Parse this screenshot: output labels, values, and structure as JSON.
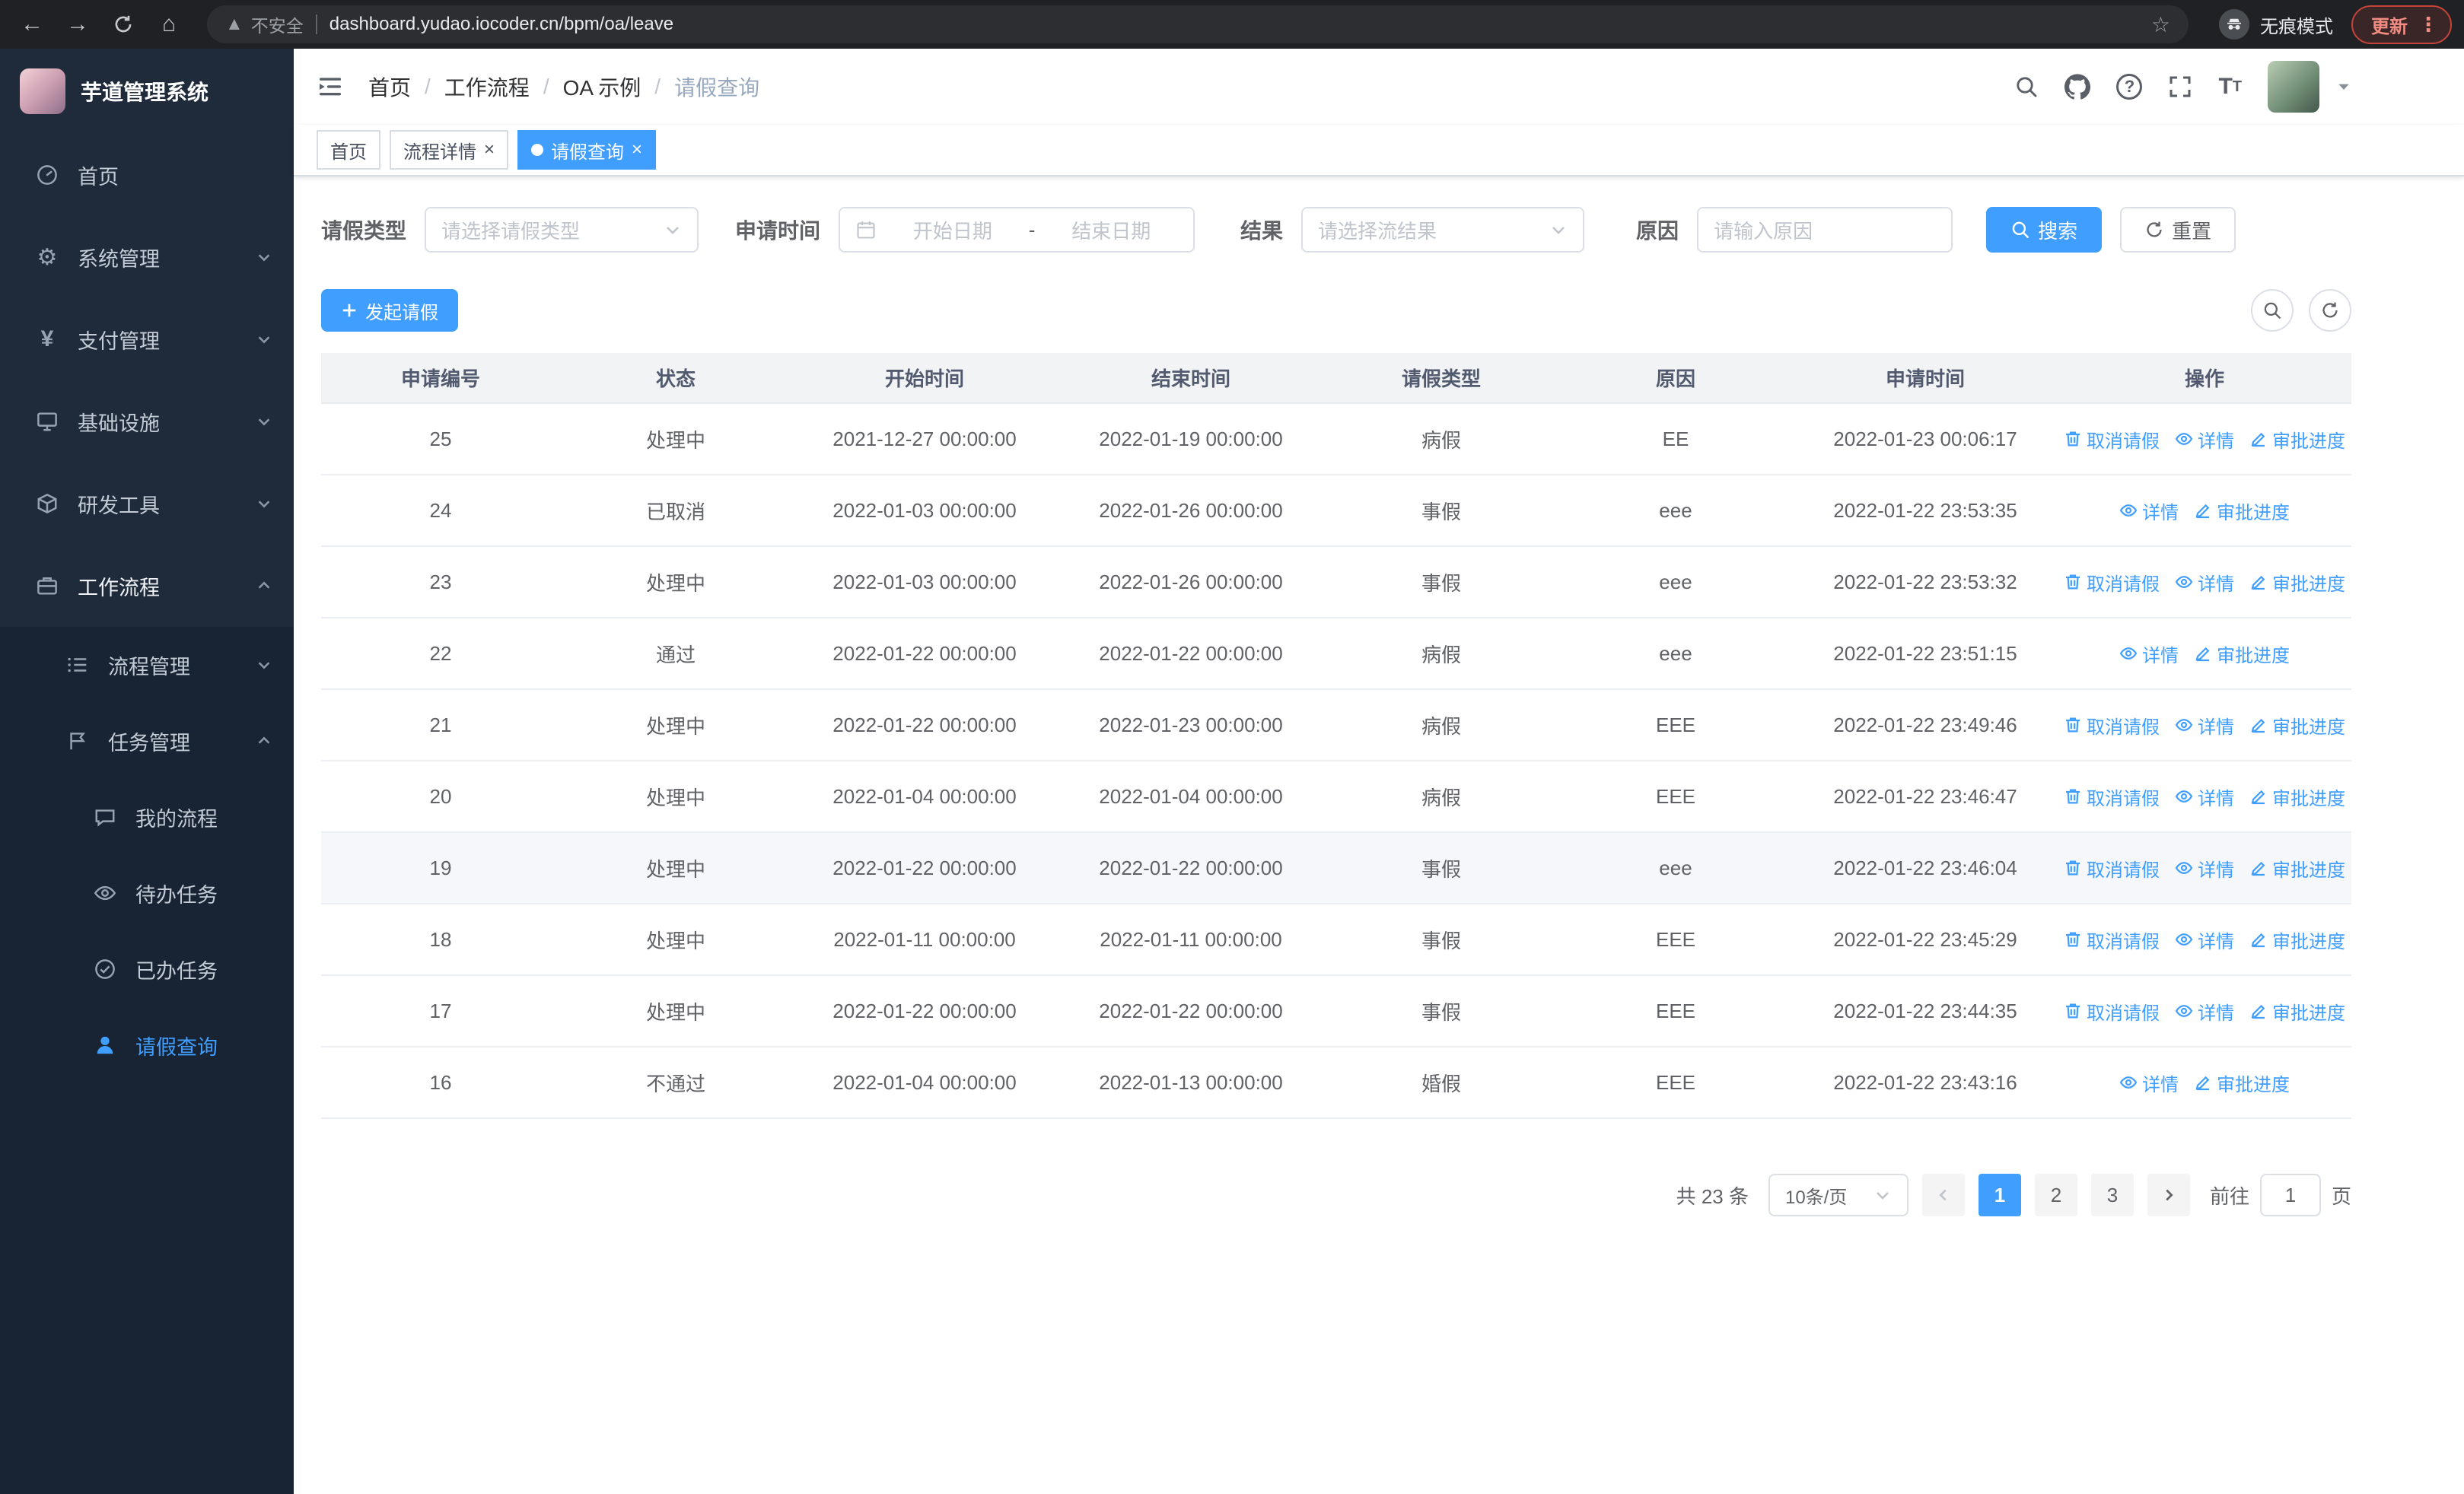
{
  "browser": {
    "security_label": "不安全",
    "url": "dashboard.yudao.iocoder.cn/bpm/oa/leave",
    "incognito_label": "无痕模式",
    "update_label": "更新"
  },
  "sidebar": {
    "logo_title": "芋道管理系统",
    "items": [
      {
        "label": "首页",
        "icon": "dashboard-icon"
      },
      {
        "label": "系统管理",
        "icon": "gear-icon"
      },
      {
        "label": "支付管理",
        "icon": "yen-icon"
      },
      {
        "label": "基础设施",
        "icon": "monitor-icon"
      },
      {
        "label": "研发工具",
        "icon": "toolbox-icon"
      },
      {
        "label": "工作流程",
        "icon": "briefcase-icon",
        "expanded": true
      }
    ],
    "sub_items": [
      {
        "label": "流程管理",
        "icon": "list-icon",
        "expanded": false
      },
      {
        "label": "任务管理",
        "icon": "flag-icon",
        "expanded": true
      }
    ],
    "leaf_items": [
      {
        "label": "我的流程",
        "icon": "chat-icon"
      },
      {
        "label": "待办任务",
        "icon": "eye-icon"
      },
      {
        "label": "已办任务",
        "icon": "check-circle-icon"
      },
      {
        "label": "请假查询",
        "icon": "user-icon",
        "active": true
      }
    ]
  },
  "header": {
    "breadcrumb": [
      "首页",
      "工作流程",
      "OA 示例",
      "请假查询"
    ],
    "separator": "/"
  },
  "tabs": [
    {
      "label": "首页",
      "closable": false,
      "active": false
    },
    {
      "label": "流程详情",
      "closable": true,
      "active": false
    },
    {
      "label": "请假查询",
      "closable": true,
      "active": true
    }
  ],
  "filters": {
    "leave_type_label": "请假类型",
    "leave_type_placeholder": "请选择请假类型",
    "apply_time_label": "申请时间",
    "start_date_placeholder": "开始日期",
    "range_separator": "-",
    "end_date_placeholder": "结束日期",
    "result_label": "结果",
    "result_placeholder": "请选择流结果",
    "reason_label": "原因",
    "reason_placeholder": "请输入原因",
    "search_button": "搜索",
    "reset_button": "重置"
  },
  "toolbar": {
    "create_button": "发起请假"
  },
  "table": {
    "columns": [
      "申请编号",
      "状态",
      "开始时间",
      "结束时间",
      "请假类型",
      "原因",
      "申请时间",
      "操作"
    ],
    "actions": {
      "cancel": "取消请假",
      "detail": "详情",
      "progress": "审批进度"
    },
    "rows": [
      {
        "id": "25",
        "status": "处理中",
        "start": "2021-12-27 00:00:00",
        "end": "2022-01-19 00:00:00",
        "type": "病假",
        "reason": "EE",
        "applied": "2022-01-23 00:06:17",
        "cancellable": true,
        "highlighted": false
      },
      {
        "id": "24",
        "status": "已取消",
        "start": "2022-01-03 00:00:00",
        "end": "2022-01-26 00:00:00",
        "type": "事假",
        "reason": "eee",
        "applied": "2022-01-22 23:53:35",
        "cancellable": false,
        "highlighted": false
      },
      {
        "id": "23",
        "status": "处理中",
        "start": "2022-01-03 00:00:00",
        "end": "2022-01-26 00:00:00",
        "type": "事假",
        "reason": "eee",
        "applied": "2022-01-22 23:53:32",
        "cancellable": true,
        "highlighted": false
      },
      {
        "id": "22",
        "status": "通过",
        "start": "2022-01-22 00:00:00",
        "end": "2022-01-22 00:00:00",
        "type": "病假",
        "reason": "eee",
        "applied": "2022-01-22 23:51:15",
        "cancellable": false,
        "highlighted": false
      },
      {
        "id": "21",
        "status": "处理中",
        "start": "2022-01-22 00:00:00",
        "end": "2022-01-23 00:00:00",
        "type": "病假",
        "reason": "EEE",
        "applied": "2022-01-22 23:49:46",
        "cancellable": true,
        "highlighted": false
      },
      {
        "id": "20",
        "status": "处理中",
        "start": "2022-01-04 00:00:00",
        "end": "2022-01-04 00:00:00",
        "type": "病假",
        "reason": "EEE",
        "applied": "2022-01-22 23:46:47",
        "cancellable": true,
        "highlighted": false
      },
      {
        "id": "19",
        "status": "处理中",
        "start": "2022-01-22 00:00:00",
        "end": "2022-01-22 00:00:00",
        "type": "事假",
        "reason": "eee",
        "applied": "2022-01-22 23:46:04",
        "cancellable": true,
        "highlighted": true
      },
      {
        "id": "18",
        "status": "处理中",
        "start": "2022-01-11 00:00:00",
        "end": "2022-01-11 00:00:00",
        "type": "事假",
        "reason": "EEE",
        "applied": "2022-01-22 23:45:29",
        "cancellable": true,
        "highlighted": false
      },
      {
        "id": "17",
        "status": "处理中",
        "start": "2022-01-22 00:00:00",
        "end": "2022-01-22 00:00:00",
        "type": "事假",
        "reason": "EEE",
        "applied": "2022-01-22 23:44:35",
        "cancellable": true,
        "highlighted": false
      },
      {
        "id": "16",
        "status": "不通过",
        "start": "2022-01-04 00:00:00",
        "end": "2022-01-13 00:00:00",
        "type": "婚假",
        "reason": "EEE",
        "applied": "2022-01-22 23:43:16",
        "cancellable": false,
        "highlighted": false
      }
    ]
  },
  "pagination": {
    "total_label": "共 23 条",
    "page_size": "10条/页",
    "pages": [
      "1",
      "2",
      "3"
    ],
    "active_page": "1",
    "goto_label": "前往",
    "goto_value": "1",
    "page_suffix": "页"
  },
  "colors": {
    "accent": "#409eff",
    "sidebar_bg": "#182433",
    "sidebar_panel_bg": "#1f2b3b",
    "table_header_bg": "#f2f3f5",
    "update_pill_text": "#f28b82"
  }
}
